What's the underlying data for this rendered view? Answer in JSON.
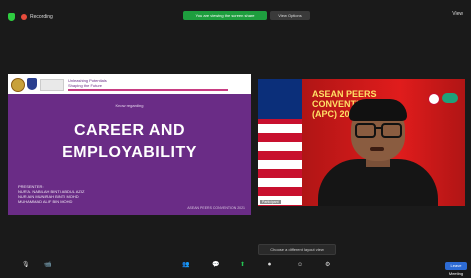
{
  "top_bar": {
    "recording_label": "Recording",
    "viewing_banner": "You are viewing the screen share",
    "view_options_label": "View Options",
    "view_label": "View"
  },
  "shared_slide": {
    "header_slogan": "Unleashing Potentials\nShaping the Future",
    "subtitle": "Know regarding",
    "title_line1": "CAREER AND",
    "title_line2": "EMPLOYABILITY",
    "presenters": "PRESENTER:\nNUR'A. NABILAH BINTI ABDUL AZIZ\nNUR AIN MUNIRAH BINTI MOHD\nMUHAMMAD ALIF BIN MOHD",
    "footer": "ASEAN PEERS CONVENTION 2021"
  },
  "video": {
    "event_title": "ASEAN PEERS\nCONVENTION\n(APC) 2021",
    "participant_name": "Participant"
  },
  "side_by_side_label": "Choose a different layout view",
  "toolbar": {
    "unmute": "🎙",
    "start_video": "📹",
    "participants": "👥",
    "chat": "💬",
    "share_screen": "⬆",
    "record": "⏺",
    "reactions": "☺",
    "apps": "⚙",
    "leave": "Leave Meeting"
  }
}
